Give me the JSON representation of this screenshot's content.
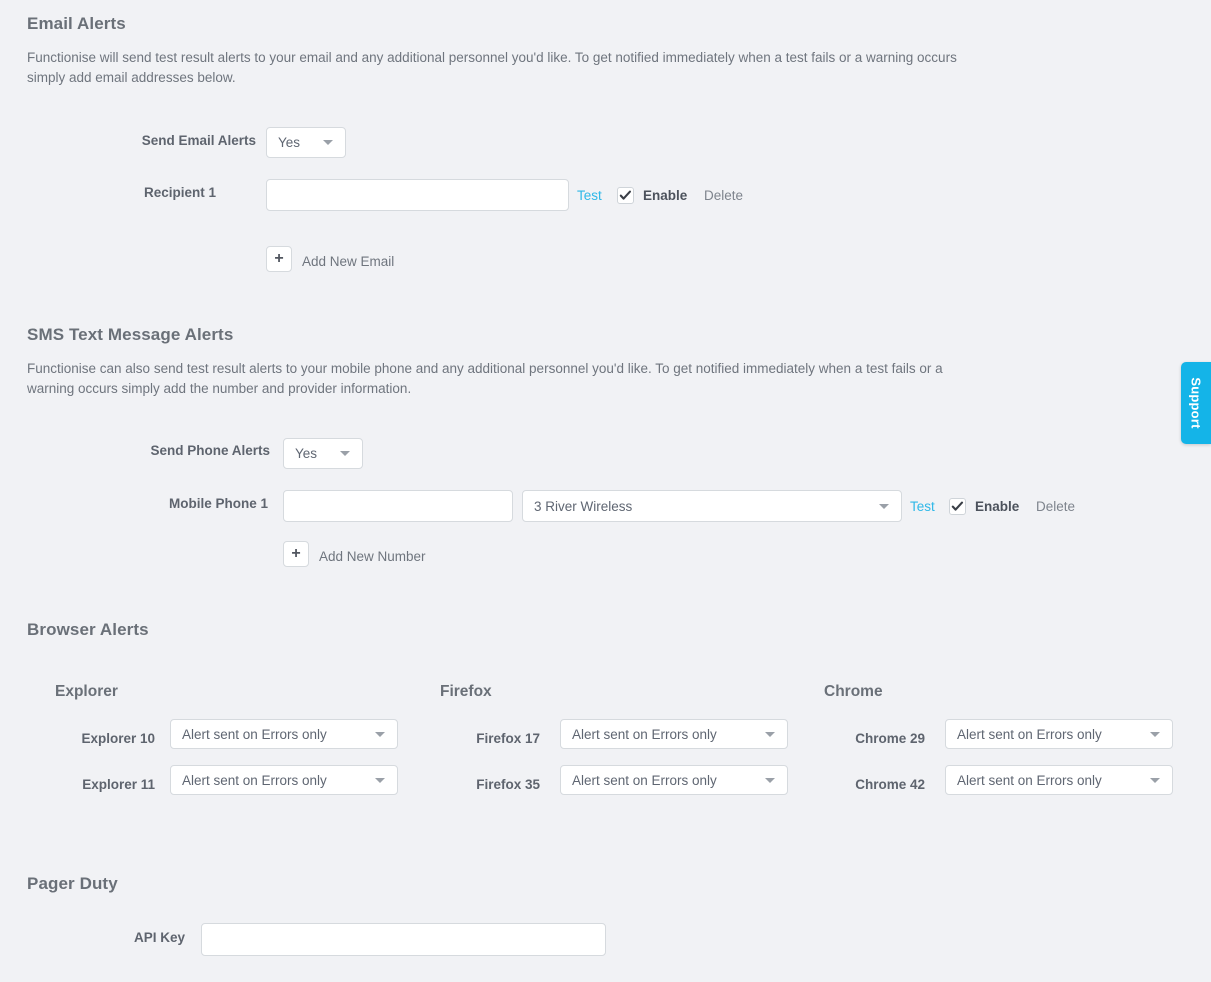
{
  "email_section": {
    "title": "Email Alerts",
    "description": "Functionise will send test result alerts to your email and any additional personnel you'd like. To get notified immediately when a test fails or a warning occurs simply add email addresses below.",
    "send_alerts_label": "Send Email Alerts",
    "send_alerts_value": "Yes",
    "recipient_label": "Recipient 1",
    "recipient_value": "",
    "recipient_placeholder": "",
    "test_label": "Test",
    "enable_label": "Enable",
    "enable_checked": true,
    "delete_label": "Delete",
    "add_icon": "plus-icon",
    "add_label": "Add New Email"
  },
  "sms_section": {
    "title": "SMS Text Message Alerts",
    "description": "Functionise can also send test result alerts to your mobile phone and any additional personnel you'd like. To get notified immediately when a test fails or a warning occurs simply add the number and provider information.",
    "send_alerts_label": "Send Phone Alerts",
    "send_alerts_value": "Yes",
    "phone_label": "Mobile Phone 1",
    "phone_value": "",
    "phone_placeholder": "",
    "provider_value": "3 River Wireless",
    "test_label": "Test",
    "enable_label": "Enable",
    "enable_checked": true,
    "delete_label": "Delete",
    "add_icon": "plus-icon",
    "add_label": "Add New Number"
  },
  "browser_section": {
    "title": "Browser Alerts",
    "columns": [
      {
        "name": "Explorer",
        "rows": [
          {
            "label": "Explorer 10",
            "value": "Alert sent on Errors only"
          },
          {
            "label": "Explorer 11",
            "value": "Alert sent on Errors only"
          }
        ]
      },
      {
        "name": "Firefox",
        "rows": [
          {
            "label": "Firefox 17",
            "value": "Alert sent on Errors only"
          },
          {
            "label": "Firefox 35",
            "value": "Alert sent on Errors only"
          }
        ]
      },
      {
        "name": "Chrome",
        "rows": [
          {
            "label": "Chrome 29",
            "value": "Alert sent on Errors only"
          },
          {
            "label": "Chrome 42",
            "value": "Alert sent on Errors only"
          }
        ]
      }
    ]
  },
  "pager_section": {
    "title": "Pager Duty",
    "api_key_label": "API Key",
    "api_key_value": "",
    "api_key_placeholder": ""
  },
  "support_tab": {
    "label": "Support",
    "color": "#14b4e8"
  },
  "colors": {
    "background": "#f1f2f5",
    "heading": "#6a7078",
    "text": "#6f757e",
    "link": "#2fb8e8",
    "border": "#d6dade",
    "field_bg": "#ffffff"
  }
}
